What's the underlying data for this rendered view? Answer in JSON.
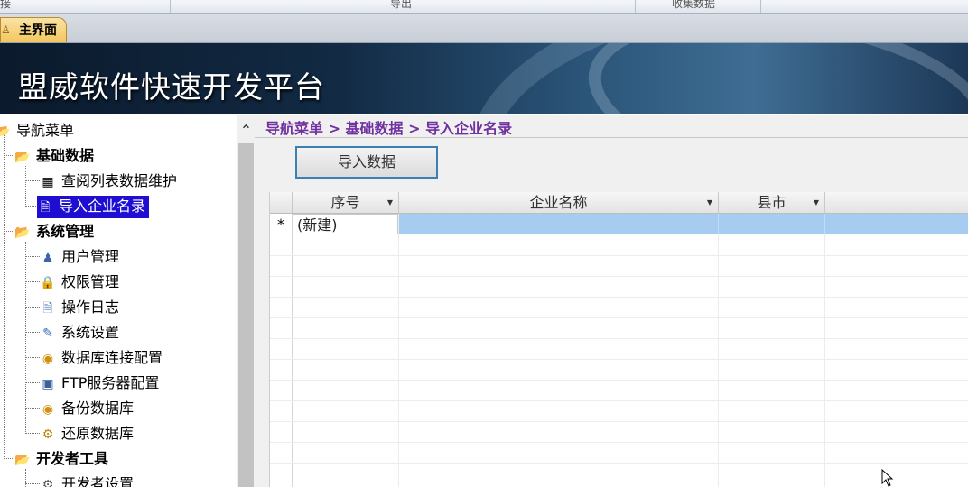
{
  "ribbon": {
    "groups": [
      "接",
      "导出",
      "收集数据"
    ]
  },
  "tabs": [
    {
      "label": "主界面",
      "icon": "user-icon"
    }
  ],
  "banner": {
    "title": "盟威软件快速开发平台"
  },
  "nav": {
    "root": "导航菜单",
    "sections": [
      {
        "label": "基础数据",
        "items": [
          {
            "label": "查阅列表数据维护",
            "icon": "table-icon"
          },
          {
            "label": "导入企业名录",
            "icon": "document-icon",
            "selected": true
          }
        ]
      },
      {
        "label": "系统管理",
        "items": [
          {
            "label": "用户管理",
            "icon": "users-icon"
          },
          {
            "label": "权限管理",
            "icon": "lock-icon"
          },
          {
            "label": "操作日志",
            "icon": "log-icon"
          },
          {
            "label": "系统设置",
            "icon": "settings-icon"
          },
          {
            "label": "数据库连接配置",
            "icon": "database-icon"
          },
          {
            "label": "FTP服务器配置",
            "icon": "server-icon"
          },
          {
            "label": "备份数据库",
            "icon": "database-icon"
          },
          {
            "label": "还原数据库",
            "icon": "restore-icon"
          }
        ]
      },
      {
        "label": "开发者工具",
        "items": [
          {
            "label": "开发者设置",
            "icon": "dev-settings-icon"
          }
        ]
      }
    ]
  },
  "main": {
    "breadcrumb": "导航菜单 > 基础数据 > 导入企业名录",
    "import_button": "导入数据",
    "grid": {
      "columns": [
        "序号",
        "企业名称",
        "县市"
      ],
      "new_row_marker": "*",
      "new_row_label": "(新建)"
    }
  },
  "colors": {
    "selected": "#1d0ed1",
    "breadcrumb": "#7030a0",
    "new_row_highlight": "#a6cdef"
  }
}
